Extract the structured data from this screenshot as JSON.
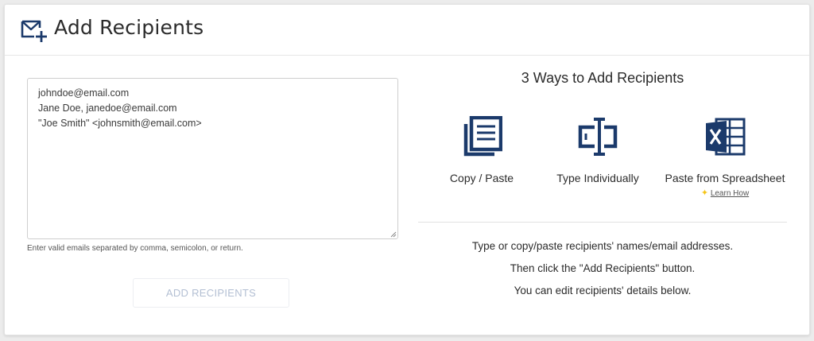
{
  "header": {
    "title": "Add Recipients",
    "icon": "mail-plus-icon"
  },
  "recipients": {
    "value": "johndoe@email.com\nJane Doe, janedoe@email.com\n\"Joe Smith\" <johnsmith@email.com>",
    "hint": "Enter valid emails separated by comma, semicolon, or return.",
    "button_label": "ADD RECIPIENTS"
  },
  "ways": {
    "title": "3 Ways to Add Recipients",
    "items": [
      {
        "icon": "copy-paste-icon",
        "label": "Copy / Paste"
      },
      {
        "icon": "type-individually-icon",
        "label": "Type Individually"
      },
      {
        "icon": "spreadsheet-icon",
        "label": "Paste from Spreadsheet",
        "link": "Learn How"
      }
    ]
  },
  "instructions": [
    "Type or copy/paste recipients' names/email addresses.",
    "Then click the \"Add Recipients\" button.",
    "You can edit recipients' details below."
  ],
  "colors": {
    "icon_navy": "#1b3a6b",
    "button_text_disabled": "#b3bfd3"
  }
}
